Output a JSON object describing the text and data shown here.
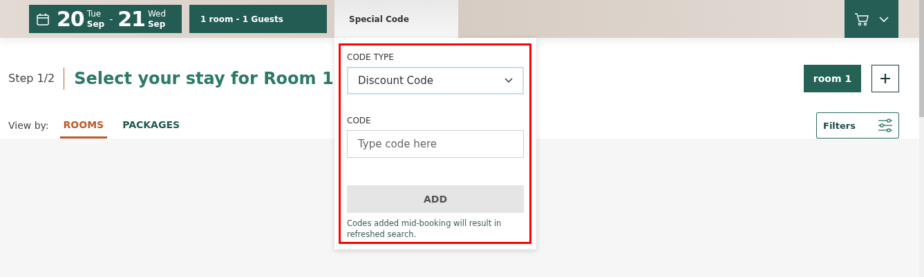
{
  "header": {
    "check_in": {
      "day": "20",
      "weekday": "Tue",
      "month": "Sep"
    },
    "separator": "-",
    "check_out": {
      "day": "21",
      "weekday": "Wed",
      "month": "Sep"
    },
    "guests": "1 room - 1 Guests",
    "special_code": {
      "label": "Special Code",
      "expanded": true
    }
  },
  "step": {
    "counter": "Step 1/2",
    "title": "Select your stay for Room 1"
  },
  "room_tabs": [
    {
      "label": "room 1",
      "selected": true
    }
  ],
  "view_by": {
    "label": "View by:",
    "tabs": [
      {
        "label": "ROOMS",
        "selected": true
      },
      {
        "label": "PACKAGES",
        "selected": false
      }
    ]
  },
  "filters": {
    "label": "Filters"
  },
  "code_popup": {
    "code_type_label": "CODE TYPE",
    "code_type_value": "Discount Code",
    "code_label": "CODE",
    "code_placeholder": "Type code here",
    "add_button": {
      "label": "ADD",
      "disabled": true
    },
    "note": "Codes added mid-booking will result in refreshed search.",
    "highlighted": true
  }
}
